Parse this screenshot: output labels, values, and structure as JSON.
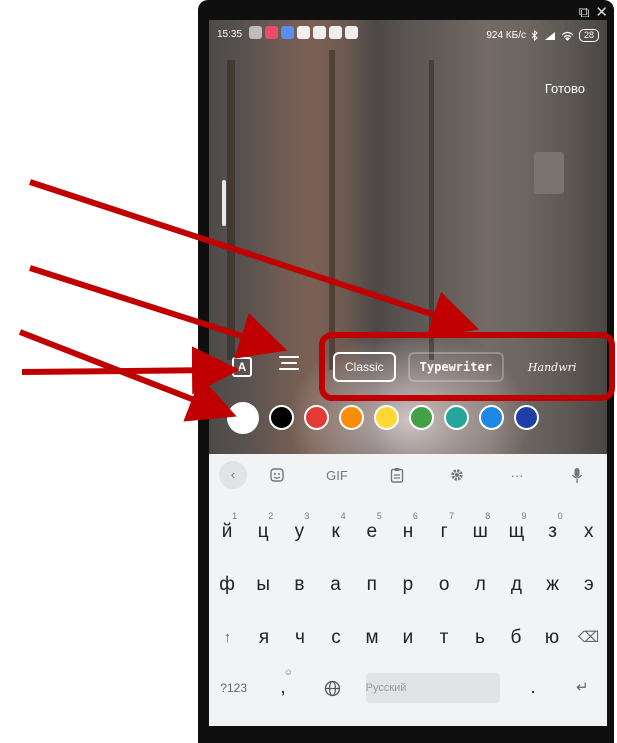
{
  "window": {
    "controls": [
      "⧉",
      "✕"
    ]
  },
  "status_bar": {
    "time": "15:35",
    "icon_colors": [
      "#bdbdbd",
      "#e84d6c",
      "#5b8df0",
      "#ffffff",
      "#ffffff",
      "#ffffff",
      "#ffffff"
    ],
    "network_speed": "924 КБ/с",
    "battery": "28"
  },
  "editor": {
    "done_label": "Готово",
    "text_style_label": "A",
    "fonts": [
      {
        "label": "Classic",
        "active": true
      },
      {
        "label": "Typewriter",
        "active": false
      },
      {
        "label": "Handwri",
        "active": false
      }
    ],
    "colors": [
      "#ffffff",
      "#000000",
      "#e53935",
      "#fb8c00",
      "#fdd835",
      "#43a047",
      "#26a69a",
      "#1e88e5",
      "#1e40a6"
    ]
  },
  "keyboard": {
    "toolbar": {
      "back": "‹",
      "gif": "GIF",
      "more": "···"
    },
    "row1": [
      {
        "key": "й",
        "hint": "1"
      },
      {
        "key": "ц",
        "hint": "2"
      },
      {
        "key": "у",
        "hint": "3"
      },
      {
        "key": "к",
        "hint": "4"
      },
      {
        "key": "е",
        "hint": "5"
      },
      {
        "key": "н",
        "hint": "6"
      },
      {
        "key": "г",
        "hint": "7"
      },
      {
        "key": "ш",
        "hint": "8"
      },
      {
        "key": "щ",
        "hint": "9"
      },
      {
        "key": "з",
        "hint": "0"
      },
      {
        "key": "х",
        "hint": ""
      }
    ],
    "row2": [
      "ф",
      "ы",
      "в",
      "а",
      "п",
      "р",
      "о",
      "л",
      "д",
      "ж",
      "э"
    ],
    "row3": [
      "я",
      "ч",
      "с",
      "м",
      "и",
      "т",
      "ь",
      "б",
      "ю"
    ],
    "shift": "↑",
    "backspace": "⌫",
    "symbols": "?123",
    "comma": ",",
    "comma_hint": "☺",
    "space_label": "Русский",
    "period": ".",
    "enter": "↵"
  },
  "annotation_colors": {
    "arrow": "#c00000",
    "highlight": "#c00000"
  }
}
